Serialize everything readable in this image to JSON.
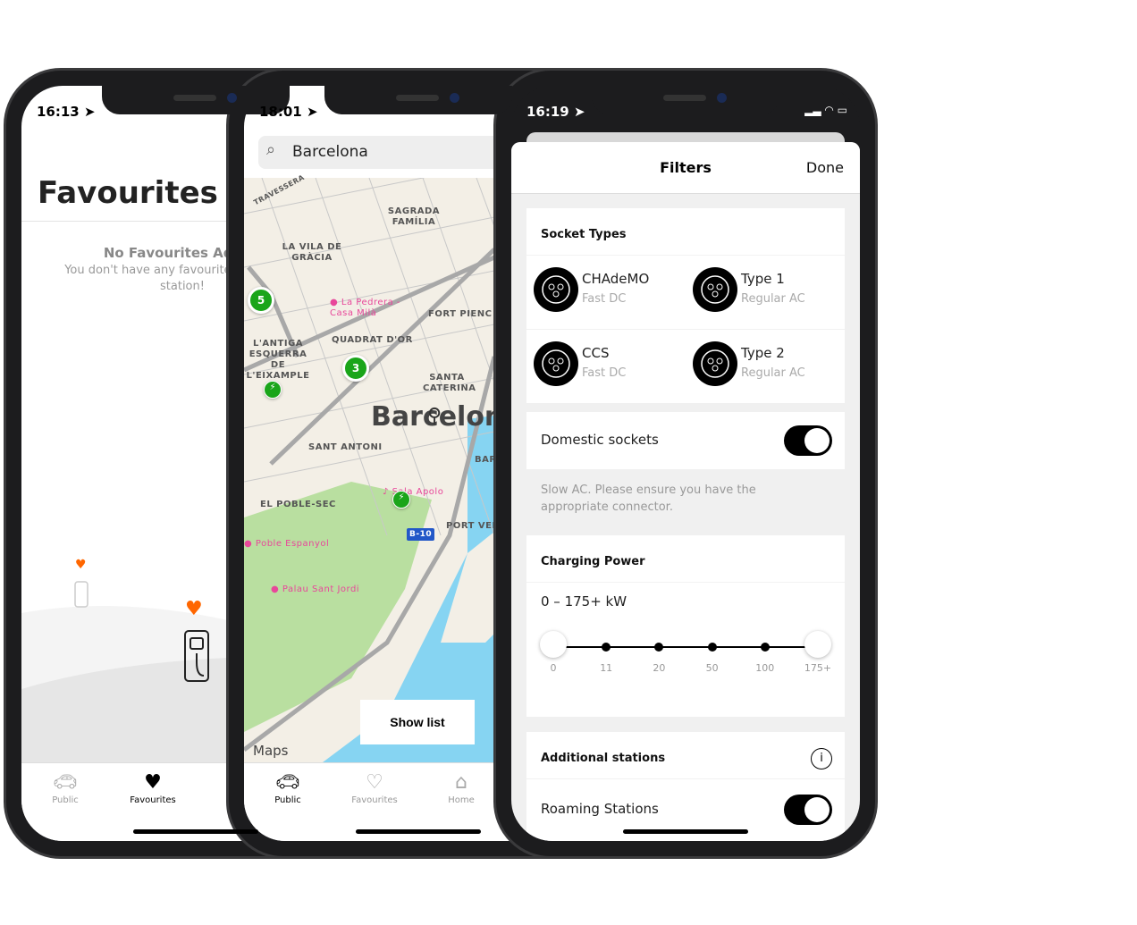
{
  "favourites_phone": {
    "time": "16:13",
    "title": "Favourites",
    "empty_title": "No Favourites Added",
    "empty_desc": "You don't have any favourites yet. Add a station!",
    "tabs": [
      {
        "label": "Public",
        "icon": "car-charging-icon"
      },
      {
        "label": "Favourites",
        "icon": "heart-icon",
        "active": true
      }
    ],
    "accent": "#ff6600"
  },
  "map_phone": {
    "time": "18:01",
    "search_value": "Barcelona",
    "labels": {
      "travessera": "TRAVESSERA",
      "sagrada": "SAGRADA FAMÍLIA",
      "vila": "LA VILA DE GRÀCIA",
      "pedrera": "La Pedrera - Casa Milà",
      "fortpienc": "FORT PIENC",
      "quadrat": "QUADRAT D'OR",
      "antiga": "L'ANTIGA ESQUERRA DE L'EIXAMPLE",
      "caterina": "SANTA CATERINA",
      "city": "Barcelona",
      "santantoni": "SANT ANTONI",
      "bar": "BAR",
      "apolo": "Sala Apolo",
      "poblesec": "EL POBLE-SEC",
      "portvell": "PORT VELL",
      "b10": "B-10",
      "poble": "Poble Espanyol",
      "palau": "Palau Sant Jordi",
      "maps": "Maps"
    },
    "clusters": [
      "5",
      "3"
    ],
    "show_list": "Show list",
    "tabs": [
      {
        "label": "Public",
        "icon": "car-charging-icon",
        "active": true
      },
      {
        "label": "Favourites",
        "icon": "heart-icon"
      },
      {
        "label": "Home",
        "icon": "home-charger-icon"
      }
    ],
    "station_color": "#1aa51a"
  },
  "filters_phone": {
    "time": "16:19",
    "title": "Filters",
    "done": "Done",
    "socket_types_title": "Socket Types",
    "sockets": [
      {
        "name": "CHAdeMO",
        "type": "Fast DC"
      },
      {
        "name": "Type 1",
        "type": "Regular AC"
      },
      {
        "name": "CCS",
        "type": "Fast DC"
      },
      {
        "name": "Type 2",
        "type": "Regular AC"
      }
    ],
    "domestic_label": "Domestic sockets",
    "domestic_on": true,
    "domestic_hint": "Slow AC. Please ensure you have the appropriate connector.",
    "power_title": "Charging Power",
    "power_range": "0 – 175+ kW",
    "power_ticks": [
      "0",
      "11",
      "20",
      "50",
      "100",
      "175+"
    ],
    "power_min": "0",
    "power_max": "175+",
    "additional_title": "Additional stations",
    "roaming_label": "Roaming Stations",
    "roaming_on": true
  }
}
